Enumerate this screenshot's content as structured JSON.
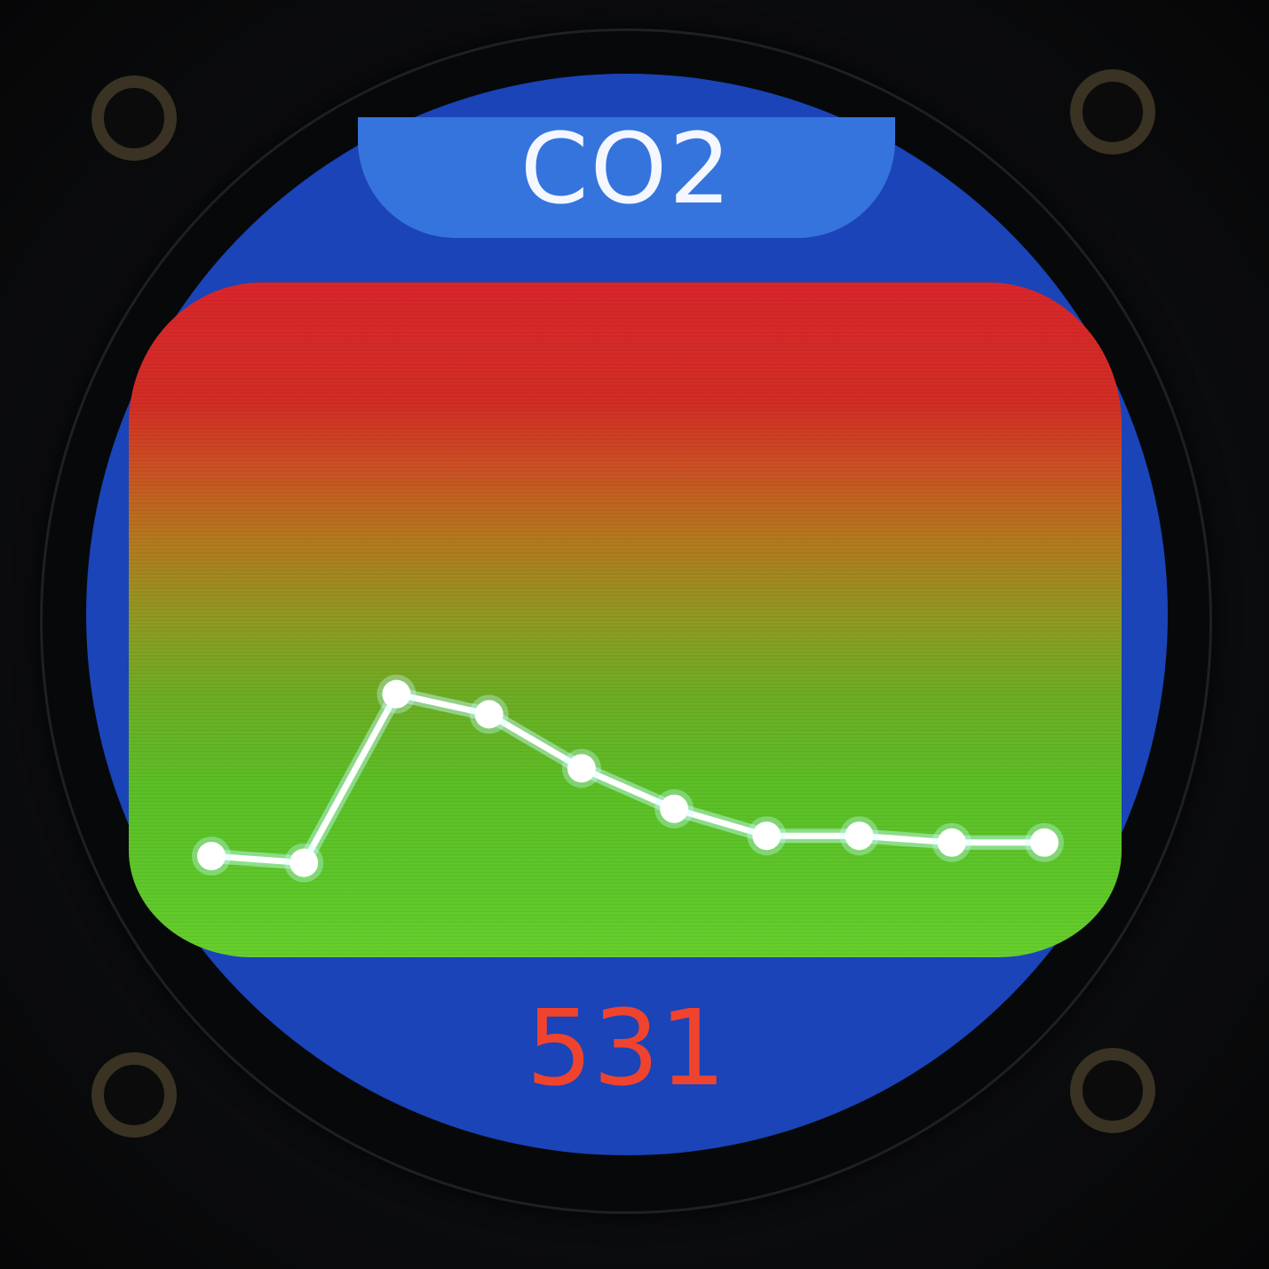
{
  "screen": {
    "title": "CO2",
    "current_value": "531"
  },
  "colors": {
    "background_blue": "#1a44b8",
    "title_pill": "#3574dc",
    "title_text": "#f4f7ff",
    "value_text": "#f0432e",
    "gradient_top": "#d8262a",
    "gradient_bottom": "#66cf2c",
    "line": "#ffffff"
  },
  "chart_data": {
    "type": "line",
    "points": [
      {
        "index": 1,
        "level": 0.15
      },
      {
        "index": 2,
        "level": 0.14
      },
      {
        "index": 3,
        "level": 0.39
      },
      {
        "index": 4,
        "level": 0.36
      },
      {
        "index": 5,
        "level": 0.28
      },
      {
        "index": 6,
        "level": 0.22
      },
      {
        "index": 7,
        "level": 0.18
      },
      {
        "index": 8,
        "level": 0.18
      },
      {
        "index": 9,
        "level": 0.17
      },
      {
        "index": 10,
        "level": 0.17
      }
    ],
    "ylim": [
      0,
      1
    ],
    "grid": false,
    "legend": "none"
  }
}
